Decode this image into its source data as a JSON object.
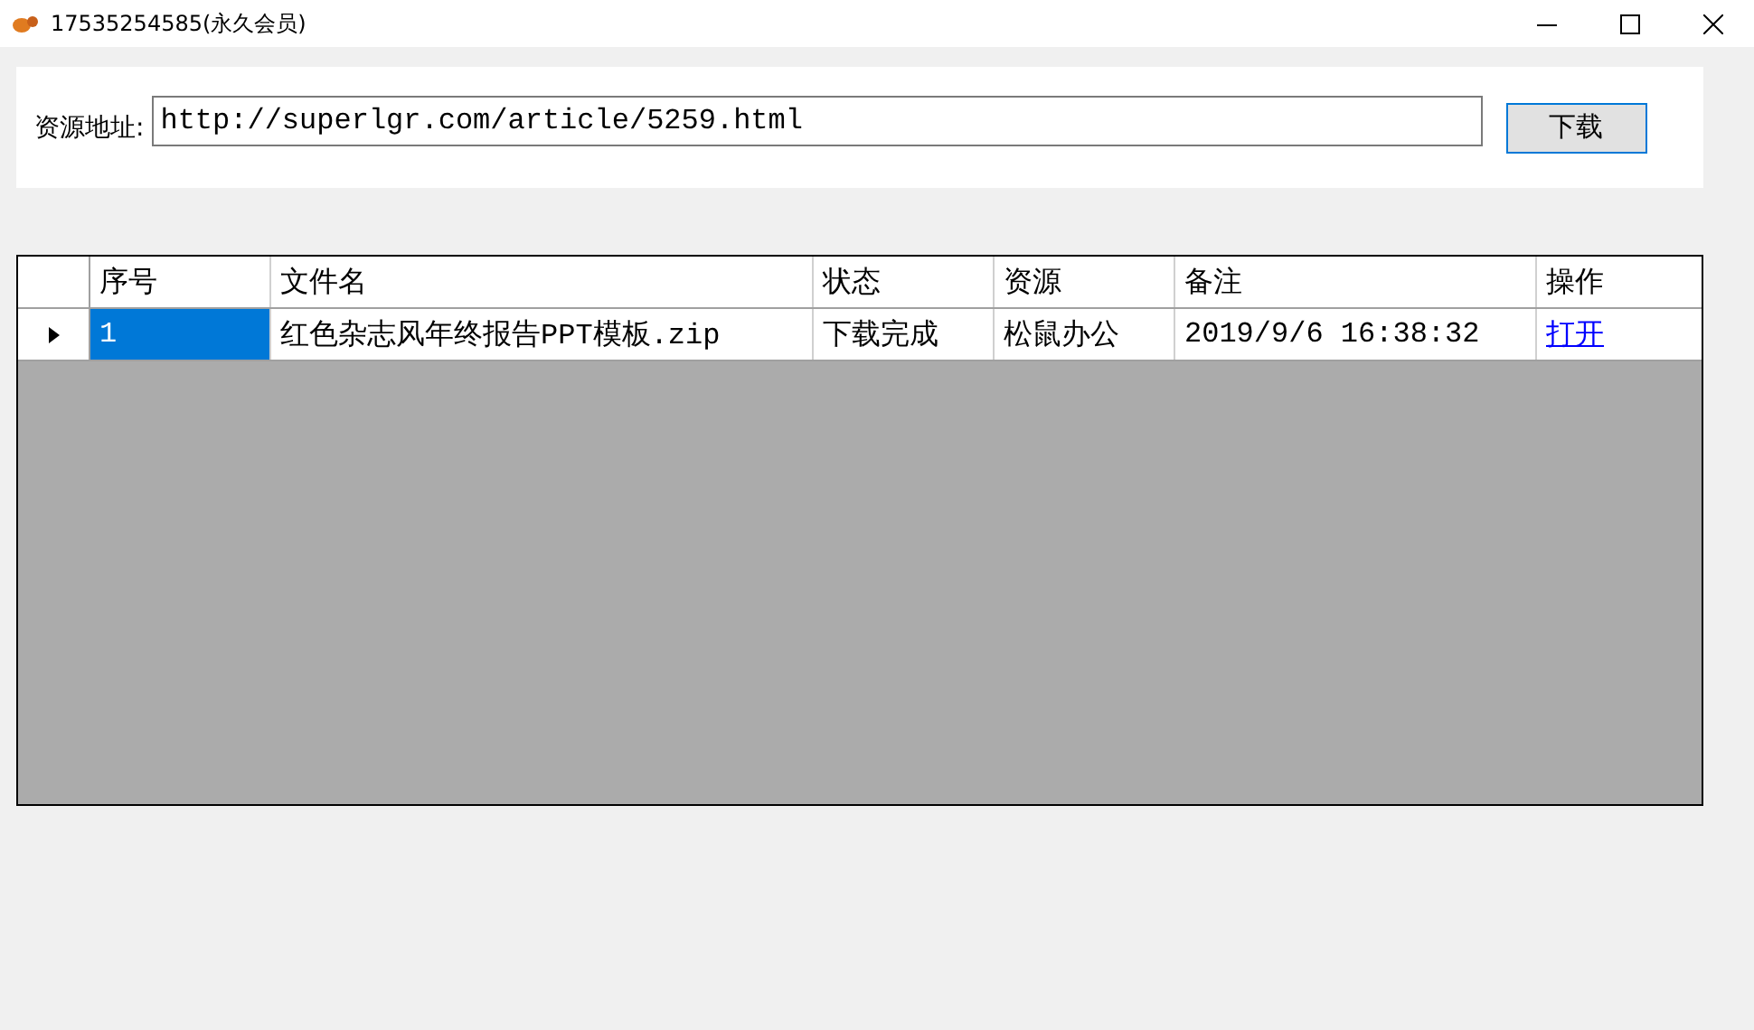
{
  "window": {
    "title": "17535254585(永久会员)"
  },
  "form": {
    "label": "资源地址:",
    "url": "http://superlgr.com/article/5259.html",
    "button": "下载"
  },
  "table": {
    "columns": [
      "序号",
      "文件名",
      "状态",
      "资源",
      "备注",
      "操作"
    ],
    "rows": [
      {
        "current": true,
        "cells": [
          {
            "kind": "text",
            "text": "1",
            "selected": true
          },
          {
            "kind": "text",
            "text": "红色杂志风年终报告PPT模板.zip",
            "selected": false
          },
          {
            "kind": "text",
            "text": "下载完成",
            "selected": false
          },
          {
            "kind": "text",
            "text": "松鼠办公",
            "selected": false
          },
          {
            "kind": "text",
            "text": "2019/9/6 16:38:32",
            "selected": false
          },
          {
            "kind": "link",
            "text": "打开",
            "selected": false
          }
        ]
      }
    ]
  }
}
